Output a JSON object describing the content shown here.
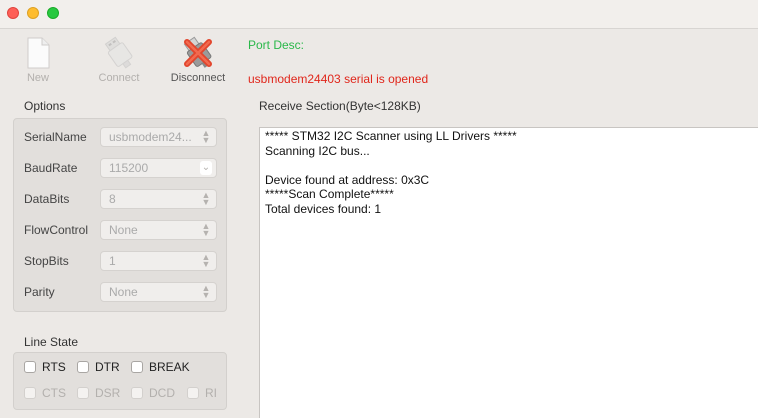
{
  "toolbar": {
    "new_label": "New",
    "connect_label": "Connect",
    "disconnect_label": "Disconnect"
  },
  "port_desc": "Port Desc:",
  "status_message": "usbmodem24403 serial is opened",
  "options": {
    "title": "Options",
    "fields": [
      {
        "label": "SerialName",
        "value": "usbmodem24..."
      },
      {
        "label": "BaudRate",
        "value": "115200"
      },
      {
        "label": "DataBits",
        "value": "8"
      },
      {
        "label": "FlowControl",
        "value": "None"
      },
      {
        "label": "StopBits",
        "value": "1"
      },
      {
        "label": "Parity",
        "value": "None"
      }
    ]
  },
  "line_state": {
    "title": "Line State",
    "rts": "RTS",
    "dtr": "DTR",
    "break": "BREAK",
    "cts": "CTS",
    "dsr": "DSR",
    "dcd": "DCD",
    "ri": "RI"
  },
  "receive": {
    "title": "Receive Section(Byte<128KB)",
    "lines": [
      "***** STM32 I2C Scanner using LL Drivers *****",
      "Scanning I2C bus...",
      "",
      "Device found at address: 0x3C",
      "*****Scan Complete*****",
      "Total devices found: 1"
    ]
  },
  "colors": {
    "status_red": "#e0261b",
    "port_desc_green": "#2ab84a"
  }
}
